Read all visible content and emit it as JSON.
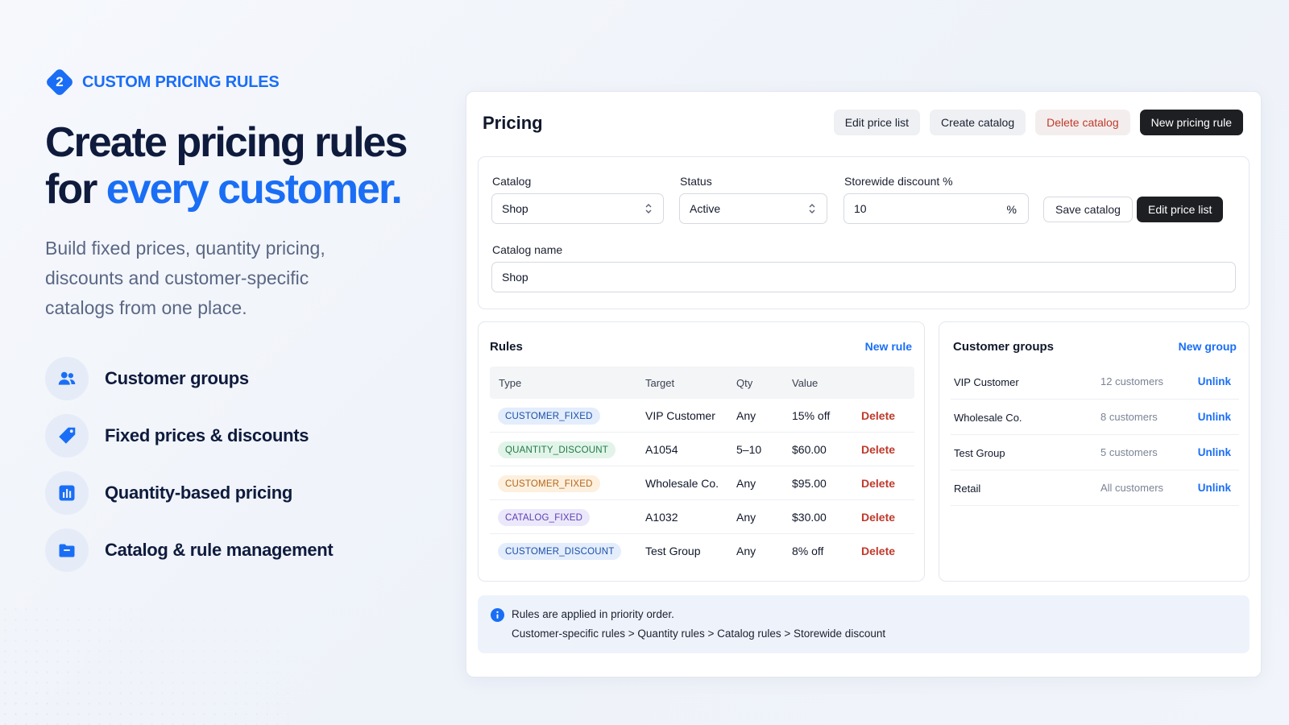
{
  "intro": {
    "step_number": "2",
    "step_label": "CUSTOM PRICING RULES",
    "headline_line1": "Create pricing rules",
    "headline_line2_prefix": "for ",
    "headline_line2_accent": "every customer.",
    "lead": "Build fixed prices, quantity pricing, discounts and customer-specific catalogs from one place.",
    "features": [
      {
        "label": "Customer groups",
        "icon": "users-icon"
      },
      {
        "label": "Fixed prices & discounts",
        "icon": "tag-icon"
      },
      {
        "label": "Quantity-based pricing",
        "icon": "bar-chart-icon"
      },
      {
        "label": "Catalog & rule management",
        "icon": "folder-icon"
      }
    ]
  },
  "pricing": {
    "title": "Pricing",
    "actions": {
      "edit_price_list": "Edit price list",
      "create_catalog": "Create catalog",
      "delete_catalog": "Delete catalog",
      "new_pricing_rule": "New pricing rule"
    },
    "catalog_form": {
      "catalog_label": "Catalog",
      "catalog_value": "Shop",
      "status_label": "Status",
      "status_value": "Active",
      "discount_label": "Storewide discount %",
      "discount_value": "10",
      "discount_suffix": "%",
      "save_catalog": "Save catalog",
      "edit_price_list": "Edit price list",
      "catalog_name_label": "Catalog name",
      "catalog_name_value": "Shop"
    },
    "rules": {
      "title": "Rules",
      "new_rule": "New rule",
      "columns": {
        "type": "Type",
        "target": "Target",
        "qty": "Qty",
        "value": "Value"
      },
      "delete_label": "Delete",
      "rows": [
        {
          "type": "CUSTOMER_FIXED",
          "target": "VIP Customer",
          "qty": "Any",
          "value": "15% off"
        },
        {
          "type": "QUANTITY_DISCOUNT",
          "target": "A1054",
          "qty": "5–10",
          "value": "$60.00"
        },
        {
          "type": "CUSTOMER_FIXED",
          "target": "Wholesale Co.",
          "qty": "Any",
          "value": "$95.00"
        },
        {
          "type": "CATALOG_FIXED",
          "target": "A1032",
          "qty": "Any",
          "value": "$30.00"
        },
        {
          "type": "CUSTOMER_DISCOUNT",
          "target": "Test Group",
          "qty": "Any",
          "value": "8% off"
        }
      ]
    },
    "groups": {
      "title": "Customer groups",
      "new_group": "New group",
      "unlink_label": "Unlink",
      "rows": [
        {
          "name": "VIP Customer",
          "count": "12 customers"
        },
        {
          "name": "Wholesale Co.",
          "count": "8 customers"
        },
        {
          "name": "Test Group",
          "count": "5 customers"
        },
        {
          "name": "Retail",
          "count": "All customers"
        }
      ]
    },
    "info": {
      "line1": "Rules are applied in priority order.",
      "line2": "Customer-specific rules > Quantity rules > Catalog rules > Storewide discount"
    }
  },
  "colors": {
    "accent": "#1a6ef5",
    "danger": "#c0392b",
    "dark_button": "#1d1f23",
    "pill_blue_bg": "#e3edfc",
    "pill_blue_fg": "#1c4fa8",
    "pill_green_bg": "#e2f4e9",
    "pill_green_fg": "#1f7a46",
    "pill_orange_bg": "#fdf0de",
    "pill_orange_fg": "#b4651a",
    "pill_purple_bg": "#ece8fb",
    "pill_purple_fg": "#5b3fb0"
  }
}
